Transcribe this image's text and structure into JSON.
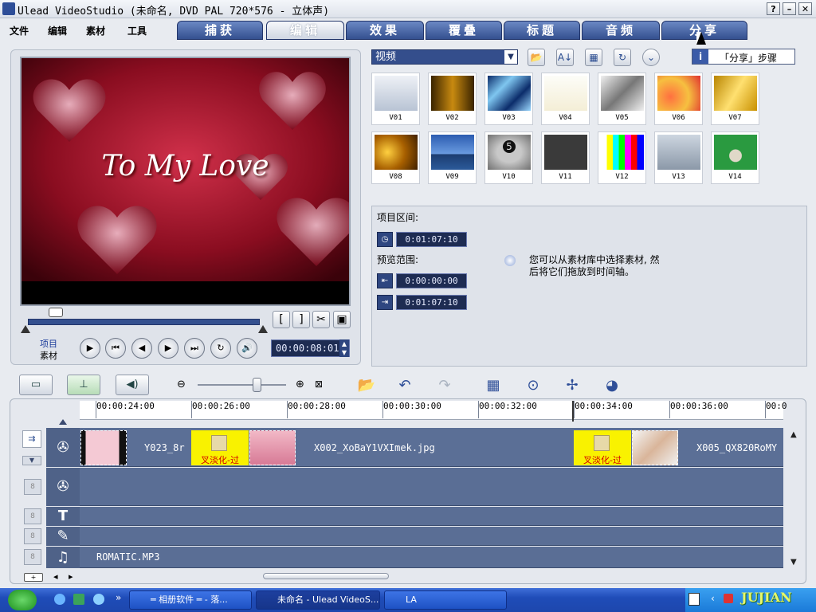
{
  "window": {
    "title": "Ulead VideoStudio (未命名, DVD PAL 720*576 - 立体声)",
    "help": "?",
    "minimize": "–",
    "close": "✕"
  },
  "menu": [
    "文件",
    "编辑",
    "素材",
    "工具"
  ],
  "tabs": [
    "捕获",
    "编辑",
    "效果",
    "覆叠",
    "标题",
    "音频",
    "分享"
  ],
  "preview": {
    "overlay_text": "To My Love",
    "mode_project": "项目",
    "mode_clip": "素材",
    "timecode": "00:00:08:01",
    "mark_in": "[",
    "mark_out": "]"
  },
  "library": {
    "category": "视频",
    "share_hint": "「分享」步骤",
    "thumbnails": [
      "V01",
      "V02",
      "V03",
      "V04",
      "V05",
      "V06",
      "V07",
      "V08",
      "V09",
      "V10",
      "V11",
      "V12",
      "V13",
      "V14"
    ]
  },
  "info": {
    "project_range_label": "项目区间:",
    "project_duration": "0:01:07:10",
    "preview_range_label": "预览范围:",
    "preview_start": "0:00:00:00",
    "preview_end": "0:01:07:10",
    "tip_line1": "您可以从素材库中选择素材, 然",
    "tip_line2": "后将它们拖放到时间轴。"
  },
  "timeline": {
    "ruler_labels": [
      "00:00:24:00",
      "00:00:26:00",
      "00:00:28:00",
      "00:00:30:00",
      "00:00:32:00",
      "00:00:34:00",
      "00:00:36:00",
      "00:0"
    ],
    "clip_names": [
      "Y023_8r",
      "X002_XoBaY1VXImek.jpg",
      "X005_QX820RoMY"
    ],
    "transition_caption": "叉淡化-过",
    "audio_clip": "ROMATIC.MP3",
    "title_track_icon": "T"
  },
  "taskbar": {
    "tasks": [
      "═ 相册软件 ═ - 落...",
      "未命名 - Ulead VideoS...",
      "LA"
    ],
    "tray_logo": "JUJIAN"
  },
  "icons": [
    "folder-icon",
    "sort-icon",
    "library-view-icon",
    "rotate-icon",
    "expand-icon",
    "zoom-out-icon",
    "zoom-in-icon",
    "fit-icon",
    "undo-icon",
    "redo-icon",
    "scissors-icon",
    "record-icon",
    "music-note-icon"
  ],
  "colors": {
    "accent_blue": "#34508f",
    "track_blue": "#5a6e95",
    "transition_yellow": "#f9f200",
    "lcd_bg": "#1e2c52"
  }
}
